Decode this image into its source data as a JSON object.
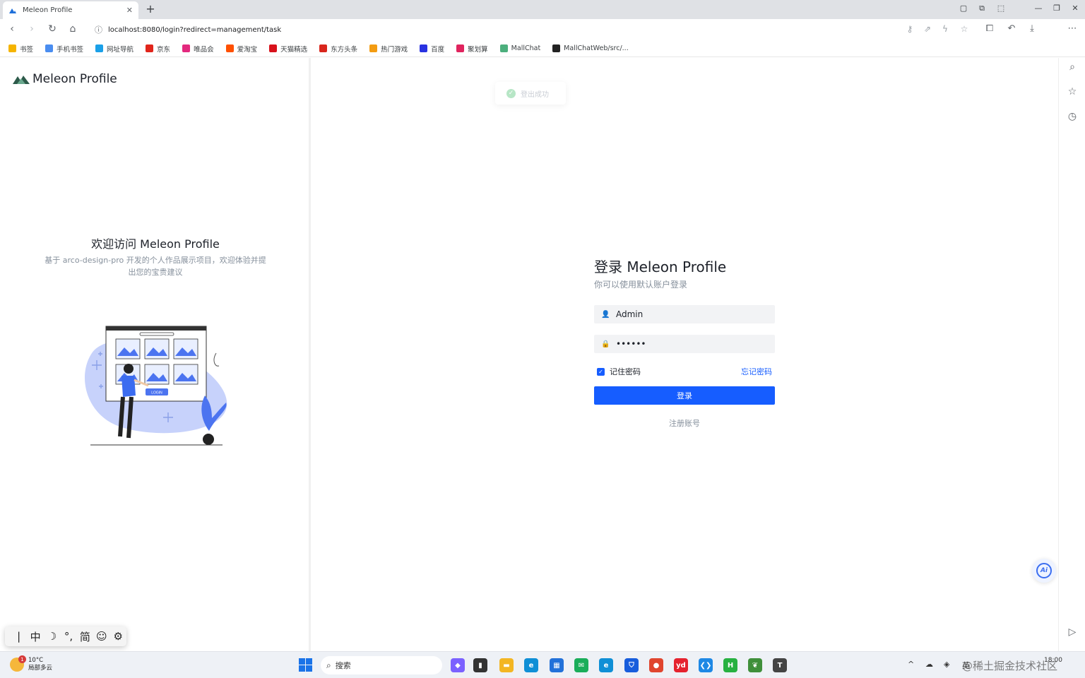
{
  "browser": {
    "tab_title": "Meleon Profile",
    "tab_close": "✕",
    "new_tab": "+",
    "url": "localhost:8080/login?redirect=management/task",
    "bookmarks": [
      {
        "label": "书签",
        "color": "#f5b400"
      },
      {
        "label": "手机书签",
        "color": "#4a8df0"
      },
      {
        "label": "网址导航",
        "color": "#1aa0e8"
      },
      {
        "label": "京东",
        "color": "#e1251b"
      },
      {
        "label": "唯品会",
        "color": "#e3297e"
      },
      {
        "label": "爱淘宝",
        "color": "#ff5000"
      },
      {
        "label": "天猫精选",
        "color": "#d8121b"
      },
      {
        "label": "东方头条",
        "color": "#d9261c"
      },
      {
        "label": "热门游戏",
        "color": "#f39c12"
      },
      {
        "label": "百度",
        "color": "#2932e1"
      },
      {
        "label": "聚划算",
        "color": "#e0245e"
      },
      {
        "label": "MallChat",
        "color": "#4caf7d"
      },
      {
        "label": "MallChatWeb/src/...",
        "color": "#222222"
      }
    ]
  },
  "left_panel": {
    "logo_text": "Meleon Profile",
    "welcome_title": "欢迎访问 Meleon Profile",
    "welcome_subtitle": "基于 arco-design-pro 开发的个人作品展示项目，欢迎体验并提出您的宝贵建议",
    "illustration_button": "LOGIN"
  },
  "toast": {
    "message": "登出成功"
  },
  "login": {
    "title": "登录 Meleon Profile",
    "subtitle": "你可以使用默认账户登录",
    "username_value": "Admin",
    "password_mask": "••••••",
    "remember_label": "记住密码",
    "remember_checked": true,
    "forgot_label": "忘记密码",
    "submit_label": "登录",
    "register_label": "注册账号"
  },
  "ai_button": {
    "label": "Ai"
  },
  "ime": {
    "items": [
      "|",
      "中",
      "☽",
      "°,",
      "简",
      "☺",
      "⚙"
    ]
  },
  "taskbar": {
    "weather_temp": "10°C",
    "weather_desc": "局部多云",
    "weather_badge": "1",
    "search_placeholder": "搜索",
    "apps": [
      {
        "name": "copilot",
        "color": "#7b61ff",
        "glyph": "◆"
      },
      {
        "name": "terminal",
        "color": "#333333",
        "glyph": "▮"
      },
      {
        "name": "explorer",
        "color": "#f3b623",
        "glyph": "▬"
      },
      {
        "name": "edge",
        "color": "#0f8fd6",
        "glyph": "e"
      },
      {
        "name": "store",
        "color": "#2271d9",
        "glyph": "▦"
      },
      {
        "name": "wechat-app",
        "color": "#1aad5a",
        "glyph": "✉"
      },
      {
        "name": "edge-active",
        "color": "#0f8fd6",
        "glyph": "e"
      },
      {
        "name": "bitwarden",
        "color": "#175ddc",
        "glyph": "⛉"
      },
      {
        "name": "chrome",
        "color": "#e0452e",
        "glyph": "●"
      },
      {
        "name": "youdao",
        "color": "#e5222e",
        "glyph": "yd"
      },
      {
        "name": "vscode",
        "color": "#1e88e5",
        "glyph": "❮❯"
      },
      {
        "name": "hbuilder",
        "color": "#27b141",
        "glyph": "H"
      },
      {
        "name": "mongodb",
        "color": "#3f8f3a",
        "glyph": "❦"
      },
      {
        "name": "typora",
        "color": "#444444",
        "glyph": "T"
      }
    ],
    "tray_lang": "英",
    "time": "18:00"
  },
  "watermark": "@稀土掘金技术社区"
}
